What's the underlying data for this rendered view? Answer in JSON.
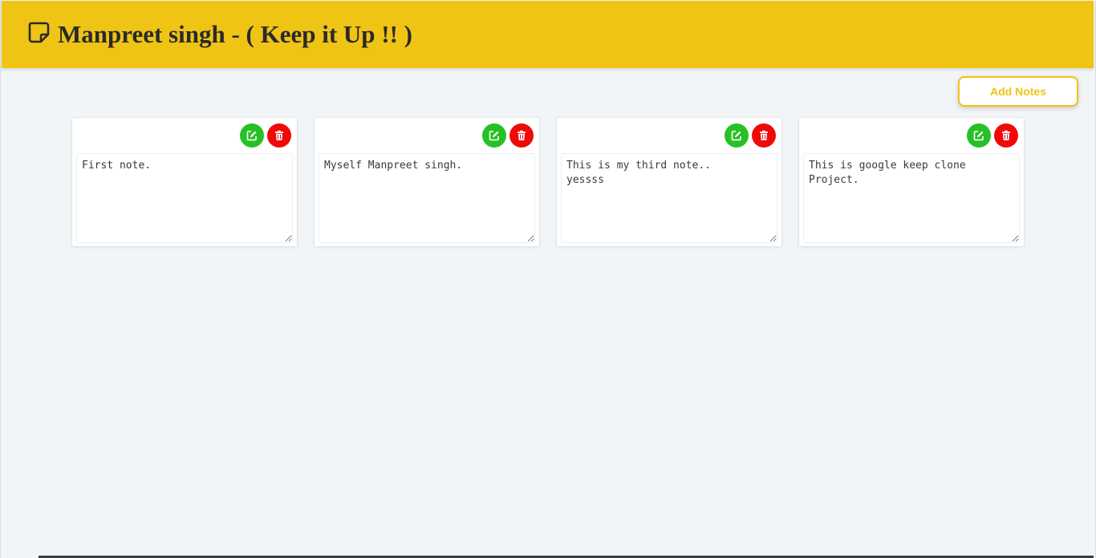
{
  "header": {
    "title": "Manpreet singh - ( Keep it Up !! )",
    "icon": "sticky-note-icon",
    "background": "#f0c414"
  },
  "actions": {
    "add_label": "Add Notes"
  },
  "notes": [
    {
      "text": "First note."
    },
    {
      "text": "Myself Manpreet singh."
    },
    {
      "text": "This is my third note..\nyessss"
    },
    {
      "text": "This is google keep clone\nProject."
    }
  ],
  "icons": {
    "edit": "edit-icon",
    "delete": "trash-icon"
  },
  "colors": {
    "accent": "#f0c414",
    "edit": "#27c127",
    "delete": "#ef0a0a",
    "page_background": "#f2f5f7"
  }
}
